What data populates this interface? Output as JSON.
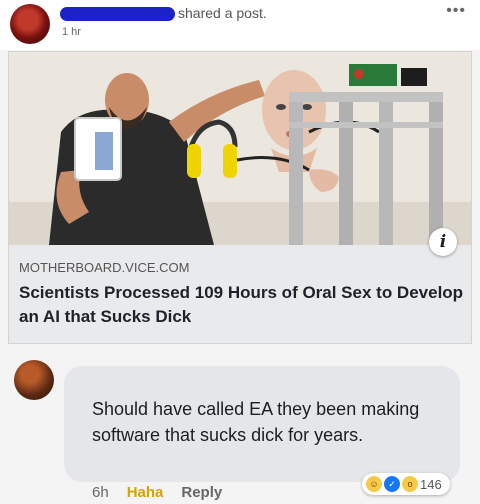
{
  "post": {
    "action_text": "shared a post.",
    "timestamp": "1 hr",
    "more_label": "•••"
  },
  "link": {
    "domain": "MOTHERBOARD.VICE.COM",
    "title": "Scientists Processed 109 Hours of Oral Sex to Develop an AI that Sucks Dick",
    "info_label": "i"
  },
  "comment": {
    "text": "Should have called EA they been making software that sucks dick for years.",
    "time": "6h",
    "reaction_label": "Haha",
    "reply_label": "Reply",
    "reaction_count": "146"
  }
}
